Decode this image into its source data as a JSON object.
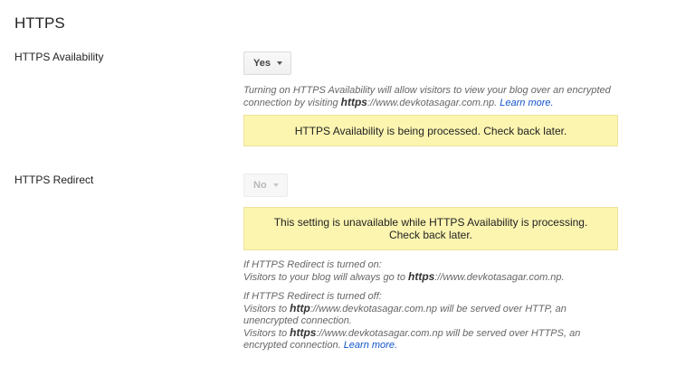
{
  "section": {
    "title": "HTTPS"
  },
  "availability": {
    "label": "HTTPS Availability",
    "select_value": "Yes",
    "help_part1": "Turning on HTTPS Availability will allow visitors to view your blog over an encrypted connection by visiting ",
    "help_bold": "https",
    "help_part2": "://www.devkotasagar.com.np. ",
    "learn_more": "Learn more.",
    "notice": "HTTPS Availability is being processed. Check back later."
  },
  "redirect": {
    "label": "HTTPS Redirect",
    "select_value": "No",
    "notice_line1": "This setting is unavailable while HTTPS Availability is processing.",
    "notice_line2": "Check back later.",
    "on_heading": "If HTTPS Redirect is turned on:",
    "on_text1": "Visitors to your blog will always go to ",
    "on_bold": "https",
    "on_text2": "://www.devkotasagar.com.np.",
    "off_heading": "If HTTPS Redirect is turned off:",
    "off_line1_pre": "Visitors to ",
    "off_line1_bold": "http",
    "off_line1_post": "://www.devkotasagar.com.np will be served over HTTP, an unencrypted connection.",
    "off_line2_pre": "Visitors to ",
    "off_line2_bold": "https",
    "off_line2_post": "://www.devkotasagar.com.np will be served over HTTPS, an encrypted connection. ",
    "learn_more": "Learn more."
  },
  "icons": {
    "dropdown": "chevron-down-icon"
  }
}
